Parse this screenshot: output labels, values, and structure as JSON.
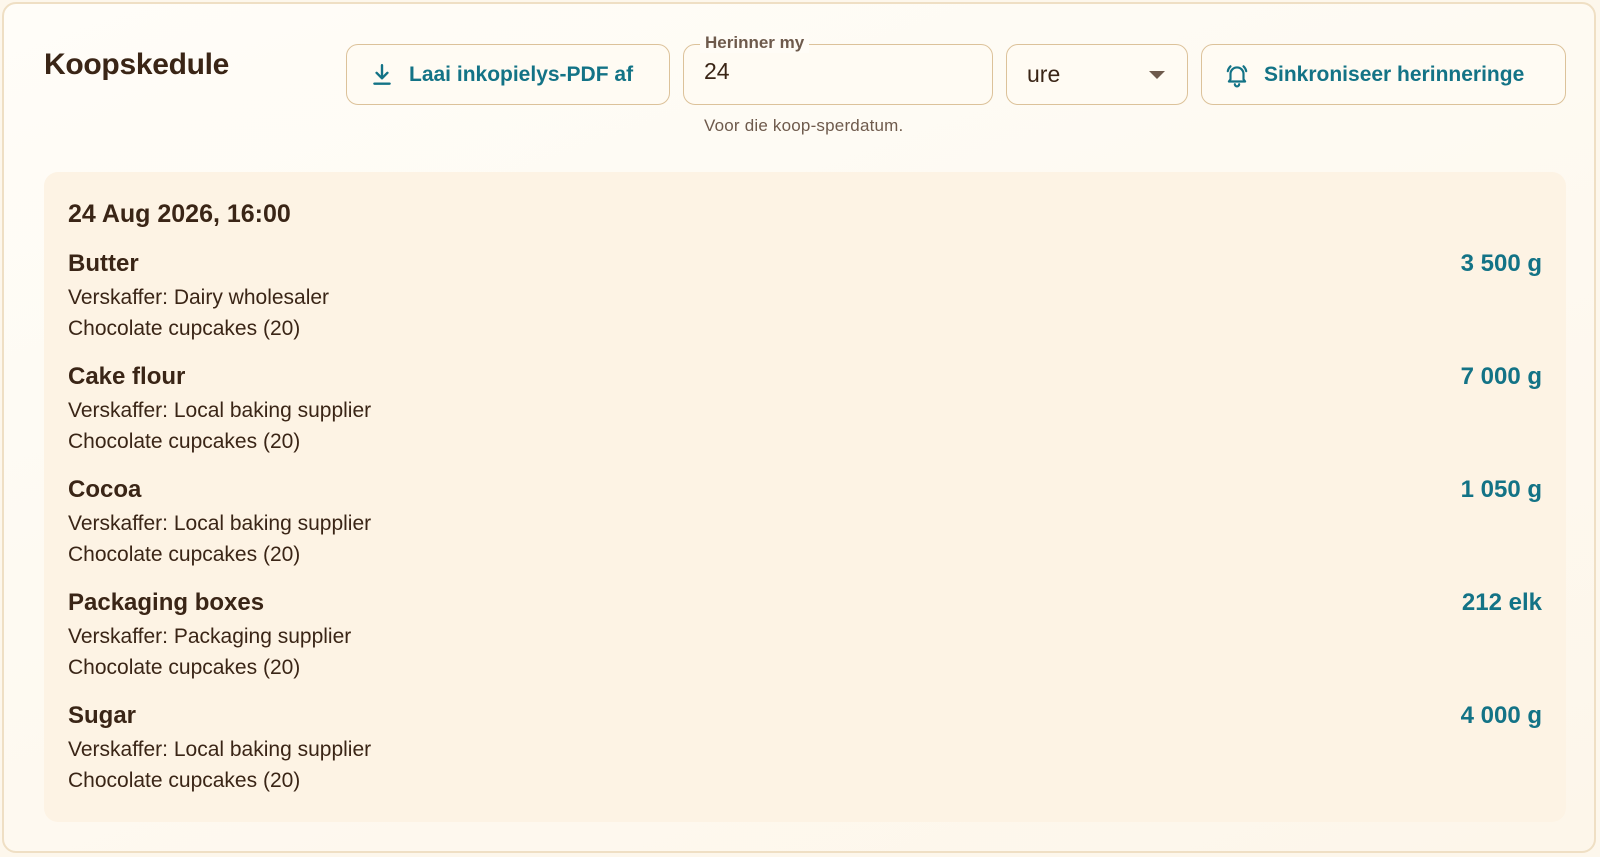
{
  "header": {
    "title": "Koopskedule",
    "download_button_label": "Laai inkopielys-PDF af",
    "reminder": {
      "label": "Herinner my",
      "value": "24",
      "helper": "Voor die koop-sperdatum.",
      "unit_selected": "ure"
    },
    "sync_button_label": "Sinkroniseer herinneringe"
  },
  "schedule": {
    "groups": [
      {
        "date": "24 Aug 2026, 16:00",
        "items": [
          {
            "name": "Butter",
            "quantity": "3 500 g",
            "supplier": "Verskaffer: Dairy wholesaler",
            "recipe": "Chocolate cupcakes (20)"
          },
          {
            "name": "Cake flour",
            "quantity": "7 000 g",
            "supplier": "Verskaffer: Local baking supplier",
            "recipe": "Chocolate cupcakes (20)"
          },
          {
            "name": "Cocoa",
            "quantity": "1 050 g",
            "supplier": "Verskaffer: Local baking supplier",
            "recipe": "Chocolate cupcakes (20)"
          },
          {
            "name": "Packaging boxes",
            "quantity": "212 elk",
            "supplier": "Verskaffer: Packaging supplier",
            "recipe": "Chocolate cupcakes (20)"
          },
          {
            "name": "Sugar",
            "quantity": "4 000 g",
            "supplier": "Verskaffer: Local baking supplier",
            "recipe": "Chocolate cupcakes (20)"
          }
        ]
      }
    ]
  },
  "icons": {
    "download": "download-icon",
    "bell": "bell-icon",
    "caret": "chevron-down-icon"
  },
  "colors": {
    "accent": "#137386",
    "text": "#3a2516",
    "panel": "#fdf3e4",
    "border": "#dcc29a"
  }
}
